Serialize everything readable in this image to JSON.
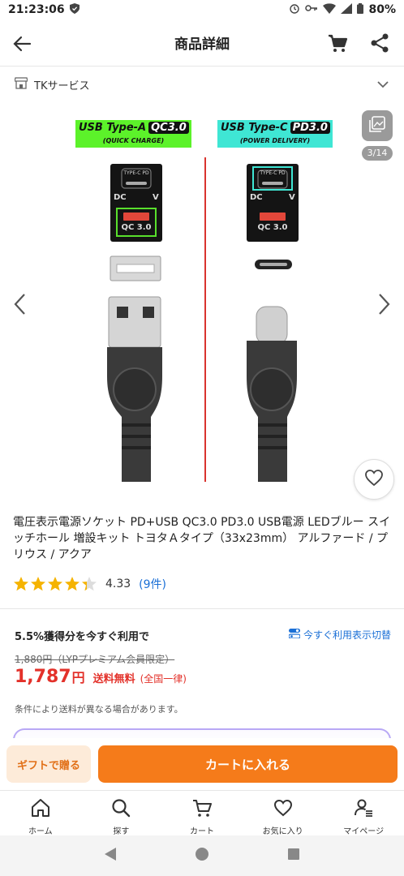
{
  "status_bar": {
    "time": "21:23:06",
    "battery": "80%"
  },
  "header": {
    "title": "商品詳細"
  },
  "store": {
    "name": "TKサービス"
  },
  "gallery": {
    "counter": "3/14",
    "left_label": {
      "line1": "USB Type-A",
      "highlight": "QC3.0",
      "line2": "(QUICK CHARGE)",
      "color": "#5cf22a"
    },
    "right_label": {
      "line1": "USB Type-C",
      "highlight": "PD3.0",
      "line2": "(POWER DELIVERY)",
      "color": "#3fe6d4"
    },
    "socket_top_text": "TYPE-C PD",
    "socket_dc": "DC",
    "socket_v": "V",
    "socket_qc": "QC 3.0"
  },
  "product": {
    "title": "電圧表示電源ソケット PD+USB QC3.0 PD3.0 USB電源 LEDブルー スイッチホール 増設キット トヨタＡタイプ（33x23mm） アルファード / プリウス / アクア",
    "rating": 4.33,
    "rating_text": "4.33",
    "review_count": "(9件)"
  },
  "pricing": {
    "promo": "5.5%獲得分を今すぐ利用で",
    "promo_toggle": "今すぐ利用表示切替",
    "original": "1,880円（LYPプレミアム会員限定）",
    "price": "1,787",
    "yen": "円",
    "shipping": "送料無料",
    "shipping_sub": "(全国一律)",
    "note": "条件により送料が異なる場合があります。"
  },
  "actions": {
    "gift": "ギフトで贈る",
    "add_to_cart": "カートに入れる"
  },
  "bottom_nav": [
    {
      "label": "ホーム",
      "icon": "home-icon"
    },
    {
      "label": "探す",
      "icon": "search-icon"
    },
    {
      "label": "カート",
      "icon": "cart-icon"
    },
    {
      "label": "お気に入り",
      "icon": "heart-icon"
    },
    {
      "label": "マイページ",
      "icon": "user-icon"
    }
  ],
  "colors": {
    "accent": "#f57b1a",
    "price_red": "#e3312a",
    "link_blue": "#1a6fd6",
    "star": "#f5b301"
  }
}
